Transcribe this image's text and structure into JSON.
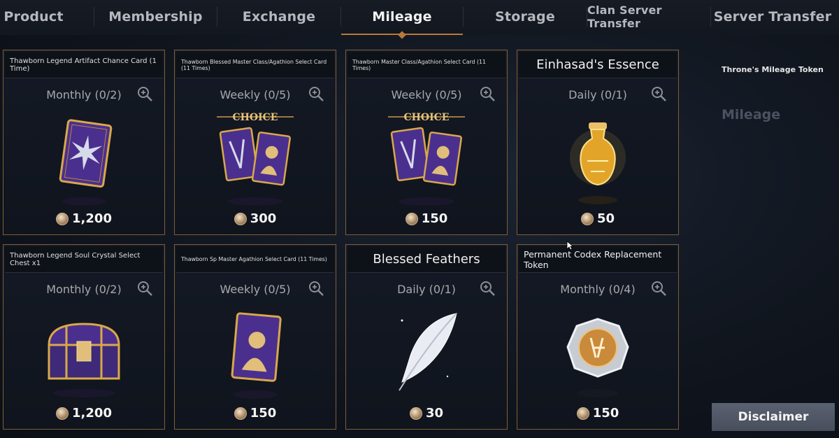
{
  "tabs": [
    {
      "label": "Product"
    },
    {
      "label": "Membership"
    },
    {
      "label": "Exchange"
    },
    {
      "label": "Mileage"
    },
    {
      "label": "Storage"
    },
    {
      "label": "Clan Server Transfer"
    },
    {
      "label": "Server Transfer"
    }
  ],
  "active_tab": "Mileage",
  "cards": [
    {
      "title": "Thawborn Legend Artifact Chance Card (1 Time)",
      "limit": "Monthly (0/2)",
      "price": "1,200",
      "icon": "artifact-card-icon"
    },
    {
      "title": "Thawborn Blessed Master Class/Agathion Select Card (11 Times)",
      "limit": "Weekly (0/5)",
      "price": "300",
      "icon": "choice-cards-icon",
      "badge": "CHOICE"
    },
    {
      "title": "Thawborn Master Class/Agathion Select Card (11 Times)",
      "limit": "Weekly (0/5)",
      "price": "150",
      "icon": "choice-cards-icon",
      "badge": "CHOICE"
    },
    {
      "title": "Einhasad's Essence",
      "limit": "Daily (0/1)",
      "price": "50",
      "icon": "golden-vase-icon"
    },
    {
      "title": "Thawborn Legend Soul Crystal Select Chest x1",
      "limit": "Monthly (0/2)",
      "price": "1,200",
      "icon": "treasure-chest-icon"
    },
    {
      "title": "Thawborn Sp Master Agathion Select Card (11 Times)",
      "limit": "Weekly (0/5)",
      "price": "150",
      "icon": "agathion-card-icon"
    },
    {
      "title": "Blessed Feathers",
      "limit": "Daily (0/1)",
      "price": "30",
      "icon": "feather-icon"
    },
    {
      "title": "Permanent Codex Replacement Token",
      "limit": "Monthly (0/4)",
      "price": "150",
      "icon": "codex-token-icon"
    }
  ],
  "sidebar": {
    "token_label": "Throne's Mileage Token",
    "mileage_label": "Mileage"
  },
  "disclaimer_label": "Disclaimer",
  "colors": {
    "accent": "#b9793b",
    "card_border": "#7d5f37",
    "card_purple": "#4b2f8f",
    "gold": "#d9a84a"
  }
}
